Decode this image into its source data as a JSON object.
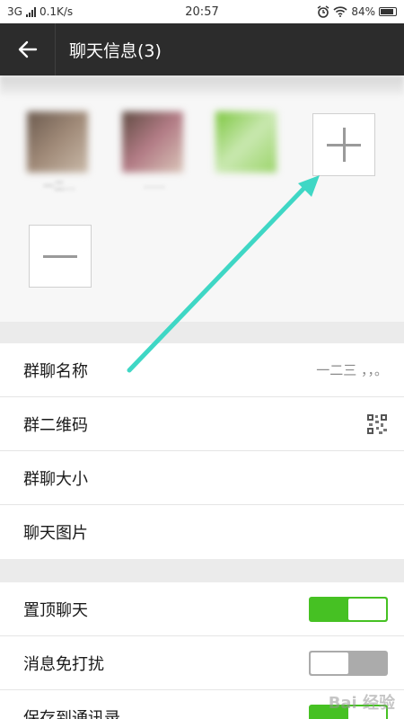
{
  "status_bar": {
    "network": "3G",
    "speed": "0.1K/s",
    "time": "20:57",
    "battery": "84%",
    "icons": [
      "signal-icon",
      "alarm-icon",
      "wifi-icon",
      "battery-icon"
    ]
  },
  "header": {
    "title": "聊天信息(3)",
    "back_icon": "back-arrow-icon"
  },
  "members": {
    "avatars": [
      {
        "name": "一二…",
        "colors": [
          "#6b5a4e",
          "#a08a78",
          "#c9b9a8"
        ]
      },
      {
        "name": "……",
        "colors": [
          "#5f4b42",
          "#b37c86",
          "#d9c4b8"
        ]
      },
      {
        "name": "",
        "colors": [
          "#7cc63f",
          "#9bd46a",
          "#c9e8b0"
        ]
      }
    ],
    "add_icon": "plus-icon",
    "remove_icon": "minus-icon"
  },
  "settings_group_1": [
    {
      "label": "群聊名称",
      "value": "一二三 ，，。"
    },
    {
      "label": "群二维码",
      "icon": "qr-code-icon"
    },
    {
      "label": "群聊大小"
    },
    {
      "label": "聊天图片"
    }
  ],
  "settings_group_2": [
    {
      "label": "置顶聊天",
      "toggle": "on"
    },
    {
      "label": "消息免打扰",
      "toggle": "off"
    },
    {
      "label": "保存到通讯录",
      "toggle": "on"
    }
  ],
  "watermark": "Bai 经验",
  "colors": {
    "title_bar": "#2c2c2c",
    "toggle_on": "#46c123",
    "toggle_off": "#ababab",
    "annotation_arrow": "#3fd7c5"
  }
}
